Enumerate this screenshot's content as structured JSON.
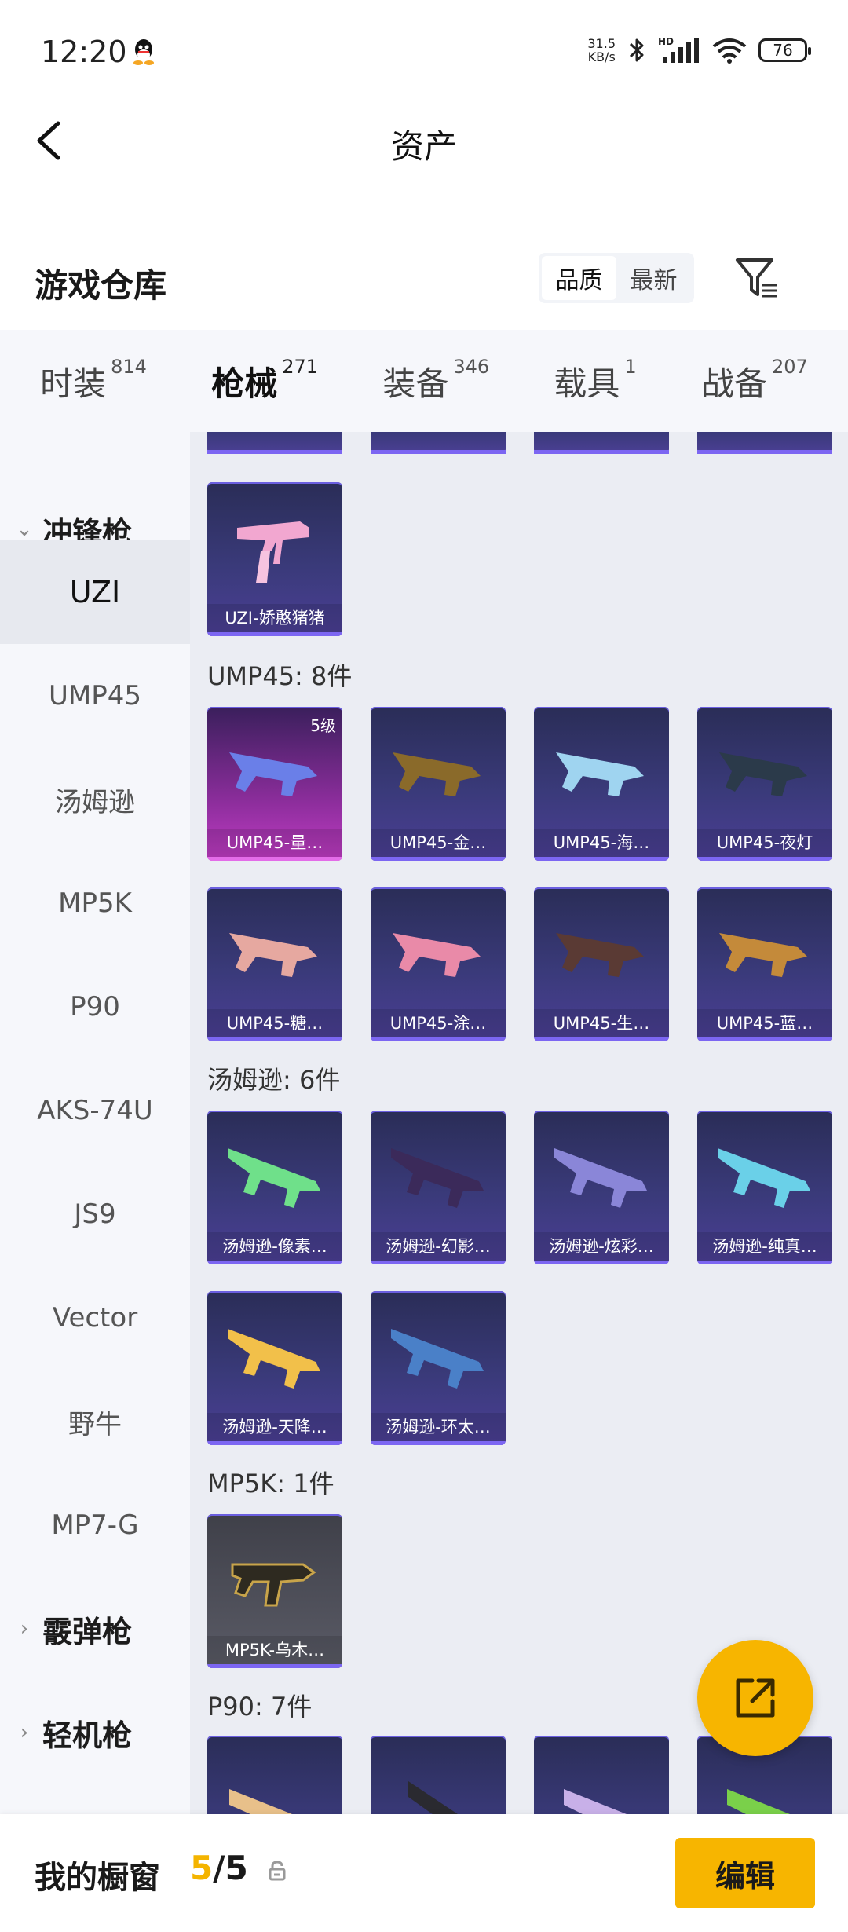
{
  "status_bar": {
    "time": "12:20",
    "net_speed_value": "31.5",
    "net_speed_unit": "KB/s",
    "battery": "76",
    "icons": [
      "qq-icon",
      "bluetooth-icon",
      "hd-signal-icon",
      "wifi-icon",
      "battery-icon"
    ]
  },
  "header": {
    "title": "资产"
  },
  "repo": {
    "title": "游戏仓库",
    "sort_options": [
      "品质",
      "最新"
    ],
    "active_sort": "品质"
  },
  "tabs": [
    {
      "label": "时装",
      "count": "814"
    },
    {
      "label": "枪械",
      "count": "271",
      "active": true
    },
    {
      "label": "装备",
      "count": "346"
    },
    {
      "label": "载具",
      "count": "1"
    },
    {
      "label": "战备",
      "count": "207"
    }
  ],
  "sidebar": {
    "group_smg": "冲锋枪",
    "items": [
      "UZI",
      "UMP45",
      "汤姆逊",
      "MP5K",
      "P90",
      "AKS-74U",
      "JS9",
      "Vector",
      "野牛",
      "MP7-G"
    ],
    "active_item": "UZI",
    "group_shotgun": "霰弹枪",
    "group_lmg": "轻机枪"
  },
  "sections": {
    "uzi": {
      "cards": [
        "UZI-娇憨猪猪"
      ]
    },
    "ump45": {
      "title": "UMP45: 8件",
      "cards": [
        "UMP45-量…",
        "UMP45-金…",
        "UMP45-海…",
        "UMP45-夜灯",
        "UMP45-糖…",
        "UMP45-涂…",
        "UMP45-生…",
        "UMP45-蓝…"
      ],
      "level_badge": "5级"
    },
    "thompson": {
      "title": "汤姆逊: 6件",
      "cards": [
        "汤姆逊-像素…",
        "汤姆逊-幻影…",
        "汤姆逊-炫彩…",
        "汤姆逊-纯真…",
        "汤姆逊-天降…",
        "汤姆逊-环太…"
      ]
    },
    "mp5k": {
      "title": "MP5K: 1件",
      "cards": [
        "MP5K-乌木…"
      ]
    },
    "p90": {
      "title": "P90: 7件"
    }
  },
  "bottom": {
    "label": "我的橱窗",
    "current": "5",
    "separator": "/",
    "total": "5",
    "edit_label": "编辑"
  },
  "colors": {
    "accent": "#f7b500",
    "card_bg": "#3a3a7a",
    "card_edge": "#7c66f2"
  }
}
